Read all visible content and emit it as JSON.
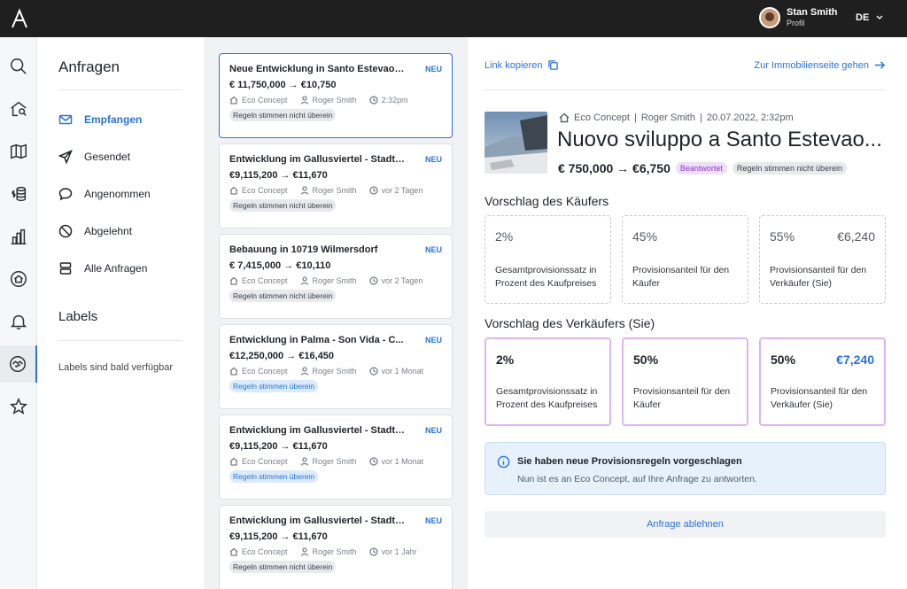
{
  "user": {
    "name": "Stan Smith",
    "subtitle": "Profil",
    "language": "DE"
  },
  "folders": {
    "title": "Anfragen",
    "items": [
      {
        "label": "Empfangen",
        "icon": "mail-icon",
        "active": true
      },
      {
        "label": "Gesendet",
        "icon": "send-icon",
        "active": false
      },
      {
        "label": "Angenommen",
        "icon": "chat-icon",
        "active": false
      },
      {
        "label": "Abgelehnt",
        "icon": "blocked-icon",
        "active": false
      },
      {
        "label": "Alle Anfragen",
        "icon": "stack-icon",
        "active": false
      }
    ],
    "labels_title": "Labels",
    "labels_empty": "Labels sind bald verfügbar"
  },
  "requests": [
    {
      "title": "Neue Entwicklung in Santo Estevao E...",
      "new_label": "NEU",
      "price": "€ 11,750,000 → €10,750",
      "agency": "Eco Concept",
      "agent": "Roger Smith",
      "time": "2:32pm",
      "badge": "Regeln stimmen nicht überein",
      "badge_type": "grey"
    },
    {
      "title": "Entwicklung im Gallusviertel - Stadtteil",
      "new_label": "NEU",
      "price": "€9,115,200 → €11,670",
      "agency": "Eco Concept",
      "agent": "Roger Smith",
      "time": "vor 2 Tagen",
      "badge": "Regeln stimmen nicht überein",
      "badge_type": "grey"
    },
    {
      "title": "Bebauung in 10719 Wilmersdorf",
      "new_label": "NEU",
      "price": "€ 7,415,000 → €10,110",
      "agency": "Eco Concept",
      "agent": "Roger Smith",
      "time": "vor 2 Tagen",
      "badge": "Regeln stimmen nicht überein",
      "badge_type": "grey"
    },
    {
      "title": "Entwicklung in Palma - Son Vida - C...",
      "new_label": "NEU",
      "price": "€12,250,000 → €16,450",
      "agency": "Eco Concept",
      "agent": "Roger Smith",
      "time": "vor 1 Monat",
      "badge": "Regeln stimmen überein",
      "badge_type": "blue"
    },
    {
      "title": "Entwicklung im Gallusviertel - Stadtteil",
      "new_label": "NEU",
      "price": "€9,115,200 → €11,670",
      "agency": "Eco Concept",
      "agent": "Roger Smith",
      "time": "vor 1 Monat",
      "badge": "Regeln stimmen überein",
      "badge_type": "blue"
    },
    {
      "title": "Entwicklung im Gallusviertel - Stadtteil",
      "new_label": "NEU",
      "price": "€9,115,200 → €11,670",
      "agency": "Eco Concept",
      "agent": "Roger Smith",
      "time": "vor 1 Jahr",
      "badge": "Regeln stimmen nicht überein",
      "badge_type": "grey"
    }
  ],
  "detail": {
    "copy_link": "Link kopieren",
    "goto_link": "Zur Immobilienseite gehen",
    "meta": {
      "agency": "Eco Concept",
      "agent": "Roger Smith",
      "datetime": "20.07.2022, 2:32pm"
    },
    "title": "Nuovo sviluppo a Santo Estevao...",
    "price": "€ 750,000 → €6,750",
    "status_tag": "Beantwortet",
    "rules_tag": "Regeln stimmen nicht überein",
    "buyer_section": "Vorschlag des Käufers",
    "seller_section": "Vorschlag des Verkäufers (Sie)",
    "buyer": [
      {
        "value": "2%",
        "amount": "",
        "label": "Gesamtprovisionssatz in Prozent des Kaufpreises"
      },
      {
        "value": "45%",
        "amount": "",
        "label": "Provisionsanteil für den Käufer"
      },
      {
        "value": "55%",
        "amount": "€6,240",
        "label": "Provisionsanteil für den Verkäufer (Sie)"
      }
    ],
    "seller": [
      {
        "value": "2%",
        "amount": "",
        "label": "Gesamtprovisionssatz in Prozent des Kaufpreises"
      },
      {
        "value": "50%",
        "amount": "",
        "label": "Provisionsanteil für den Käufer"
      },
      {
        "value": "50%",
        "amount": "€7,240",
        "label": "Provisionsanteil für den Verkäufer (Sie)"
      }
    ],
    "info_title": "Sie haben neue Provisionsregeln vorgeschlagen",
    "info_text": "Nun ist es an Eco Concept, auf Ihre Anfrage zu antworten.",
    "reject_button": "Anfrage ablehnen"
  },
  "colors": {
    "accent": "#2a73d9",
    "topbar": "#1f1f1f",
    "purple_tag": "#8e3cc2"
  }
}
